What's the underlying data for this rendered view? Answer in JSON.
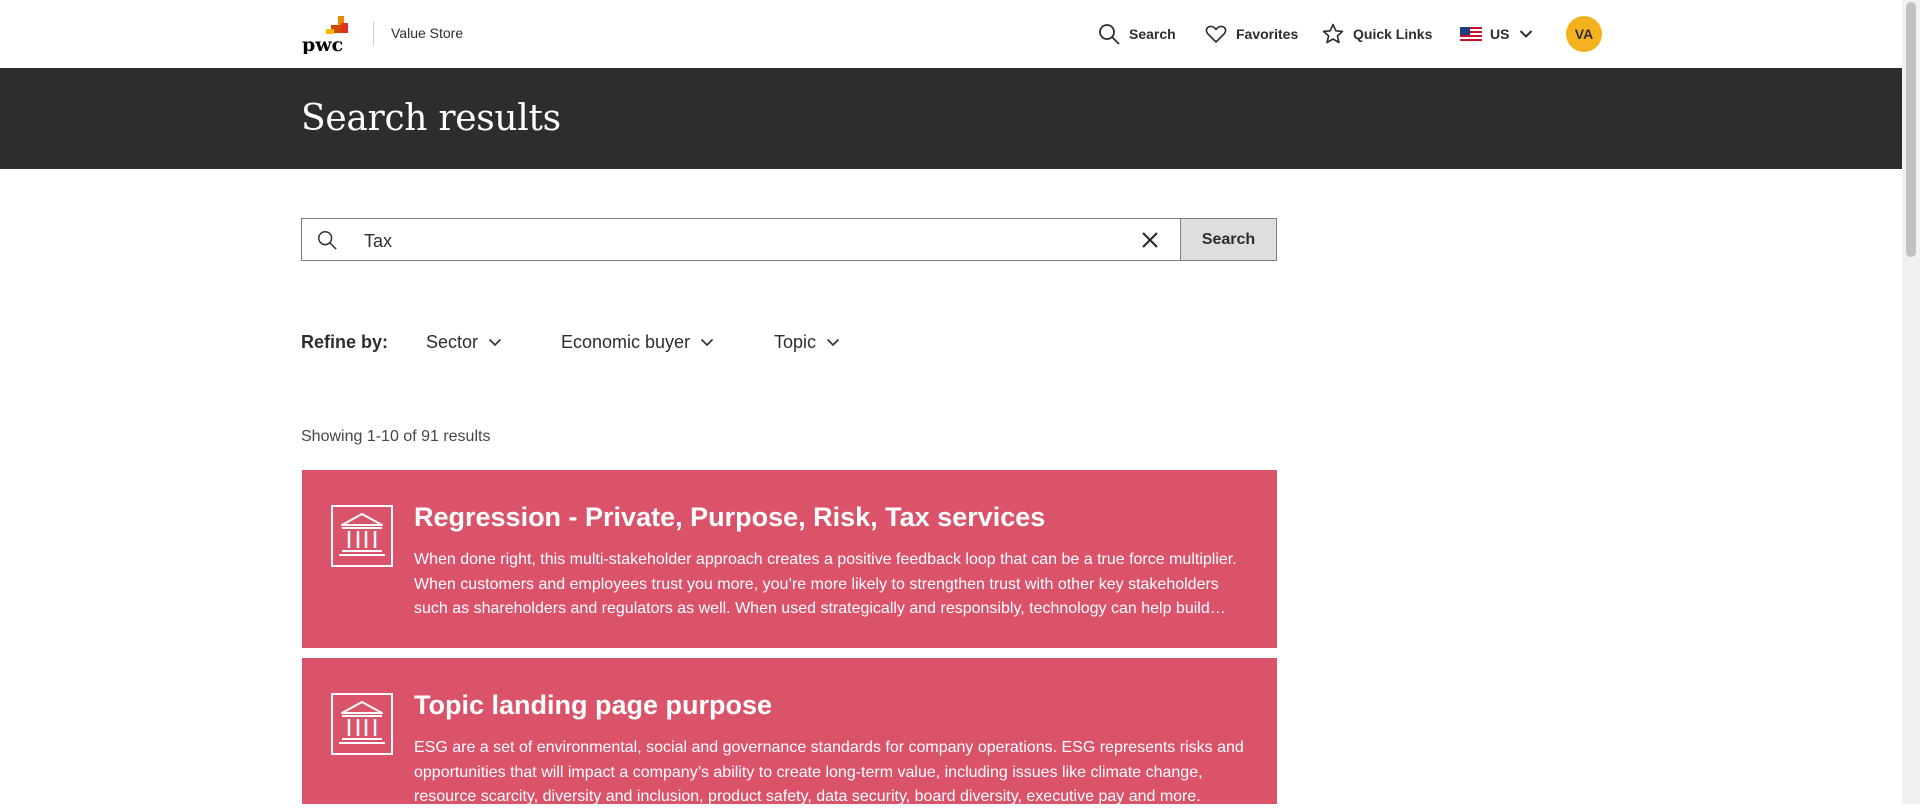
{
  "header": {
    "logo_text": "pwc",
    "store_name": "Value Store",
    "nav": {
      "search_label": "Search",
      "favorites_label": "Favorites",
      "quick_links_label": "Quick Links",
      "region_label": "US"
    },
    "avatar_initials": "VA"
  },
  "banner": {
    "title": "Search results"
  },
  "search": {
    "value": "Tax",
    "button_label": "Search"
  },
  "refine": {
    "label": "Refine by:",
    "filters": [
      "Sector",
      "Economic buyer",
      "Topic"
    ]
  },
  "results": {
    "count_text": "Showing 1-10 of 91 results",
    "items": [
      {
        "title": "Regression - Private, Purpose, Risk, Tax services",
        "description": "When done right, this multi-stakeholder approach creates a positive feedback loop that can be a true force multiplier. When customers and employees trust you more, you’re more likely to strengthen trust with other key stakeholders such as shareholders and regulators as well. When used strategically and responsibly, technology can help build trust."
      },
      {
        "title": "Topic landing page purpose",
        "description": "ESG are a set of environmental, social and governance standards for company operations. ESG represents risks and opportunities that will impact a company’s ability to create long-term value, including issues like climate change, resource scarcity, diversity and inclusion, product safety, data security, board diversity, executive pay and more."
      }
    ]
  },
  "colors": {
    "banner_bg": "#2d2d2d",
    "card_bg": "#db536a",
    "avatar_bg": "#f5b11e",
    "logo_orange": "#e0301e",
    "logo_amber": "#eb8c00"
  },
  "icons": {
    "search": "search-icon",
    "favorites": "heart-icon",
    "quick_links": "star-icon",
    "region_flag": "us-flag-icon",
    "chevron": "chevron-down-icon",
    "clear": "close-icon",
    "card": "institution-building-icon"
  }
}
